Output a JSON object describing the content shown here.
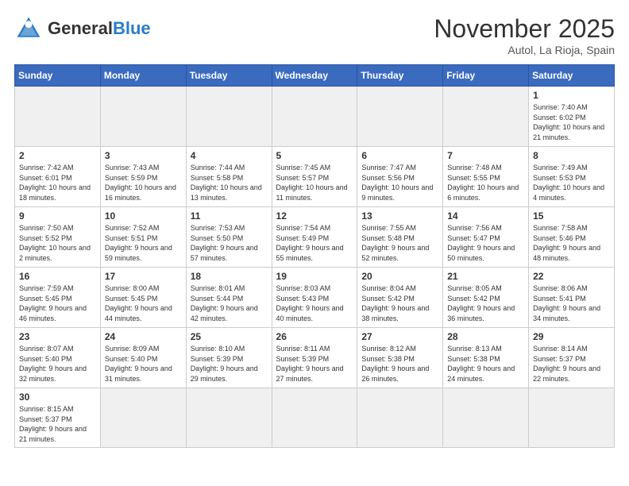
{
  "header": {
    "logo_general": "General",
    "logo_blue": "Blue",
    "month_title": "November 2025",
    "subtitle": "Autol, La Rioja, Spain"
  },
  "weekdays": [
    "Sunday",
    "Monday",
    "Tuesday",
    "Wednesday",
    "Thursday",
    "Friday",
    "Saturday"
  ],
  "weeks": [
    [
      {
        "day": "",
        "info": "",
        "empty": true
      },
      {
        "day": "",
        "info": "",
        "empty": true
      },
      {
        "day": "",
        "info": "",
        "empty": true
      },
      {
        "day": "",
        "info": "",
        "empty": true
      },
      {
        "day": "",
        "info": "",
        "empty": true
      },
      {
        "day": "",
        "info": "",
        "empty": true
      },
      {
        "day": "1",
        "info": "Sunrise: 7:40 AM\nSunset: 6:02 PM\nDaylight: 10 hours\nand 21 minutes."
      }
    ],
    [
      {
        "day": "2",
        "info": "Sunrise: 7:42 AM\nSunset: 6:01 PM\nDaylight: 10 hours\nand 18 minutes."
      },
      {
        "day": "3",
        "info": "Sunrise: 7:43 AM\nSunset: 5:59 PM\nDaylight: 10 hours\nand 16 minutes."
      },
      {
        "day": "4",
        "info": "Sunrise: 7:44 AM\nSunset: 5:58 PM\nDaylight: 10 hours\nand 13 minutes."
      },
      {
        "day": "5",
        "info": "Sunrise: 7:45 AM\nSunset: 5:57 PM\nDaylight: 10 hours\nand 11 minutes."
      },
      {
        "day": "6",
        "info": "Sunrise: 7:47 AM\nSunset: 5:56 PM\nDaylight: 10 hours\nand 9 minutes."
      },
      {
        "day": "7",
        "info": "Sunrise: 7:48 AM\nSunset: 5:55 PM\nDaylight: 10 hours\nand 6 minutes."
      },
      {
        "day": "8",
        "info": "Sunrise: 7:49 AM\nSunset: 5:53 PM\nDaylight: 10 hours\nand 4 minutes."
      }
    ],
    [
      {
        "day": "9",
        "info": "Sunrise: 7:50 AM\nSunset: 5:52 PM\nDaylight: 10 hours\nand 2 minutes."
      },
      {
        "day": "10",
        "info": "Sunrise: 7:52 AM\nSunset: 5:51 PM\nDaylight: 9 hours\nand 59 minutes."
      },
      {
        "day": "11",
        "info": "Sunrise: 7:53 AM\nSunset: 5:50 PM\nDaylight: 9 hours\nand 57 minutes."
      },
      {
        "day": "12",
        "info": "Sunrise: 7:54 AM\nSunset: 5:49 PM\nDaylight: 9 hours\nand 55 minutes."
      },
      {
        "day": "13",
        "info": "Sunrise: 7:55 AM\nSunset: 5:48 PM\nDaylight: 9 hours\nand 52 minutes."
      },
      {
        "day": "14",
        "info": "Sunrise: 7:56 AM\nSunset: 5:47 PM\nDaylight: 9 hours\nand 50 minutes."
      },
      {
        "day": "15",
        "info": "Sunrise: 7:58 AM\nSunset: 5:46 PM\nDaylight: 9 hours\nand 48 minutes."
      }
    ],
    [
      {
        "day": "16",
        "info": "Sunrise: 7:59 AM\nSunset: 5:45 PM\nDaylight: 9 hours\nand 46 minutes."
      },
      {
        "day": "17",
        "info": "Sunrise: 8:00 AM\nSunset: 5:45 PM\nDaylight: 9 hours\nand 44 minutes."
      },
      {
        "day": "18",
        "info": "Sunrise: 8:01 AM\nSunset: 5:44 PM\nDaylight: 9 hours\nand 42 minutes."
      },
      {
        "day": "19",
        "info": "Sunrise: 8:03 AM\nSunset: 5:43 PM\nDaylight: 9 hours\nand 40 minutes."
      },
      {
        "day": "20",
        "info": "Sunrise: 8:04 AM\nSunset: 5:42 PM\nDaylight: 9 hours\nand 38 minutes."
      },
      {
        "day": "21",
        "info": "Sunrise: 8:05 AM\nSunset: 5:42 PM\nDaylight: 9 hours\nand 36 minutes."
      },
      {
        "day": "22",
        "info": "Sunrise: 8:06 AM\nSunset: 5:41 PM\nDaylight: 9 hours\nand 34 minutes."
      }
    ],
    [
      {
        "day": "23",
        "info": "Sunrise: 8:07 AM\nSunset: 5:40 PM\nDaylight: 9 hours\nand 32 minutes."
      },
      {
        "day": "24",
        "info": "Sunrise: 8:09 AM\nSunset: 5:40 PM\nDaylight: 9 hours\nand 31 minutes."
      },
      {
        "day": "25",
        "info": "Sunrise: 8:10 AM\nSunset: 5:39 PM\nDaylight: 9 hours\nand 29 minutes."
      },
      {
        "day": "26",
        "info": "Sunrise: 8:11 AM\nSunset: 5:39 PM\nDaylight: 9 hours\nand 27 minutes."
      },
      {
        "day": "27",
        "info": "Sunrise: 8:12 AM\nSunset: 5:38 PM\nDaylight: 9 hours\nand 26 minutes."
      },
      {
        "day": "28",
        "info": "Sunrise: 8:13 AM\nSunset: 5:38 PM\nDaylight: 9 hours\nand 24 minutes."
      },
      {
        "day": "29",
        "info": "Sunrise: 8:14 AM\nSunset: 5:37 PM\nDaylight: 9 hours\nand 22 minutes."
      }
    ],
    [
      {
        "day": "30",
        "info": "Sunrise: 8:15 AM\nSunset: 5:37 PM\nDaylight: 9 hours\nand 21 minutes.",
        "last": true
      },
      {
        "day": "",
        "info": "",
        "empty": true,
        "last": true
      },
      {
        "day": "",
        "info": "",
        "empty": true,
        "last": true
      },
      {
        "day": "",
        "info": "",
        "empty": true,
        "last": true
      },
      {
        "day": "",
        "info": "",
        "empty": true,
        "last": true
      },
      {
        "day": "",
        "info": "",
        "empty": true,
        "last": true
      },
      {
        "day": "",
        "info": "",
        "empty": true,
        "last": true
      }
    ]
  ]
}
